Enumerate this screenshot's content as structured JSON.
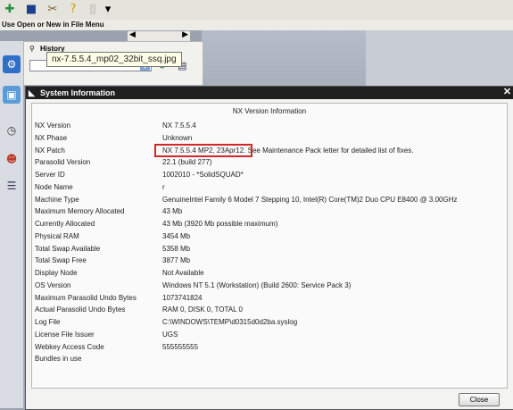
{
  "status_bar": "Use Open or New in File Menu",
  "tooltip": "nx-7.5.5.4_mp02_32bit_ssq.jpg",
  "history_label": "History",
  "dialog": {
    "title": "System Information",
    "header": "NX Version Information",
    "close_button": "Close",
    "rows": [
      {
        "label": "NX Version",
        "value": "NX 7.5.5.4"
      },
      {
        "label": "NX Phase",
        "value": "Unknown"
      },
      {
        "label": "NX Patch",
        "value": "NX 7.5.5.4 MP2, 23Apr12.  See Maintenance Pack letter for detailed list of fixes."
      },
      {
        "label": "Parasolid Version",
        "value": "22.1 (build 277)"
      },
      {
        "label": "Server ID",
        "value": "1002010 - *SolidSQUAD*"
      },
      {
        "label": "Node Name",
        "value": "r"
      },
      {
        "label": "Machine Type",
        "value": "GenuineIntel Family 6 Model 7 Stepping 10, Intel(R) Core(TM)2 Duo CPU     E8400  @ 3.00GHz"
      },
      {
        "label": "Maximum Memory Allocated",
        "value": "43 Mb"
      },
      {
        "label": "Currently Allocated",
        "value": "43 Mb (3920 Mb possible maximum)"
      },
      {
        "label": "Physical RAM",
        "value": "3454 Mb"
      },
      {
        "label": "Total Swap Available",
        "value": "5358 Mb"
      },
      {
        "label": "Total Swap Free",
        "value": "3877 Mb"
      },
      {
        "label": "Display Node",
        "value": "Not Available"
      },
      {
        "label": "OS Version",
        "value": "Windows NT 5.1 (Workstation) (Build 2600: Service Pack 3)"
      },
      {
        "label": "Maximum Parasolid Undo Bytes",
        "value": "1073741824"
      },
      {
        "label": "Actual Parasolid Undo Bytes",
        "value": "RAM 0, DISK 0, TOTAL 0"
      },
      {
        "label": "Log File",
        "value": "C:\\WINDOWS\\TEMP\\d0315d0d2ba.syslog"
      },
      {
        "label": "License File Issuer",
        "value": "UGS"
      },
      {
        "label": "Webkey Access Code",
        "value": "555555555"
      },
      {
        "label": "Bundles in use",
        "value": ""
      }
    ]
  }
}
